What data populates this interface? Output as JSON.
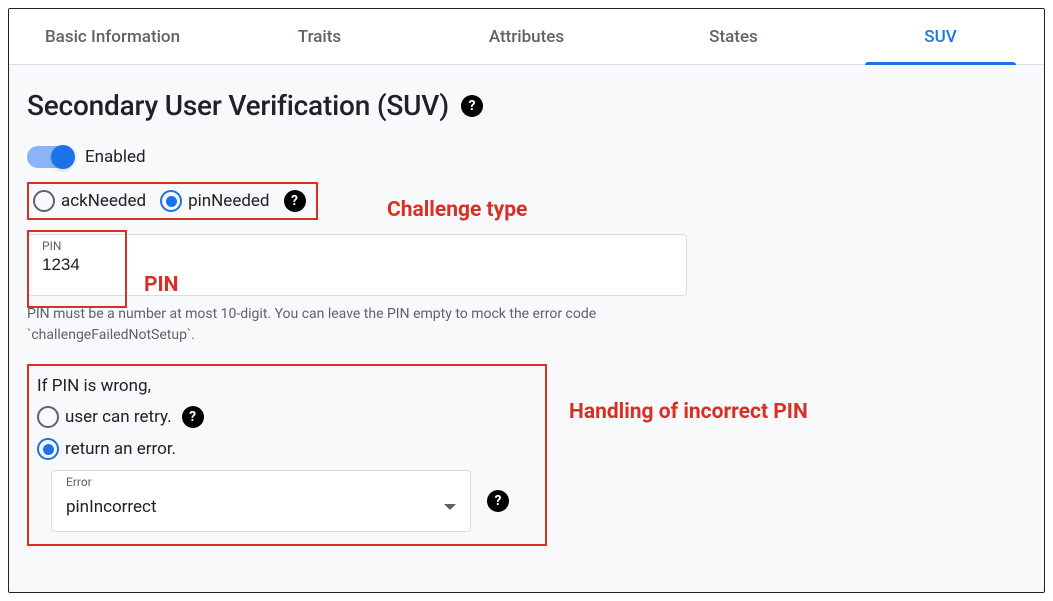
{
  "tabs": [
    {
      "label": "Basic Information",
      "active": false
    },
    {
      "label": "Traits",
      "active": false
    },
    {
      "label": "Attributes",
      "active": false
    },
    {
      "label": "States",
      "active": false
    },
    {
      "label": "SUV",
      "active": true
    }
  ],
  "page": {
    "title": "Secondary User Verification (SUV)"
  },
  "toggle": {
    "label": "Enabled",
    "checked": true
  },
  "challenge": {
    "options": {
      "ack": {
        "label": "ackNeeded",
        "checked": false
      },
      "pin": {
        "label": "pinNeeded",
        "checked": true
      }
    }
  },
  "pin_field": {
    "label": "PIN",
    "value": "1234",
    "hint": "PIN must be a number at most 10-digit. You can leave the PIN empty to mock the error code `challengeFailedNotSetup`."
  },
  "error_handling": {
    "prompt": "If PIN is wrong,",
    "options": {
      "retry": {
        "label": "user can retry.",
        "checked": false
      },
      "error": {
        "label": "return an error.",
        "checked": true
      }
    },
    "select": {
      "label": "Error",
      "value": "pinIncorrect"
    }
  },
  "annotations": {
    "challenge_type": "Challenge type",
    "pin": "PIN",
    "incorrect_pin": "Handling of incorrect PIN"
  },
  "colors": {
    "accent": "#1a73e8",
    "annotation": "#d93025"
  }
}
